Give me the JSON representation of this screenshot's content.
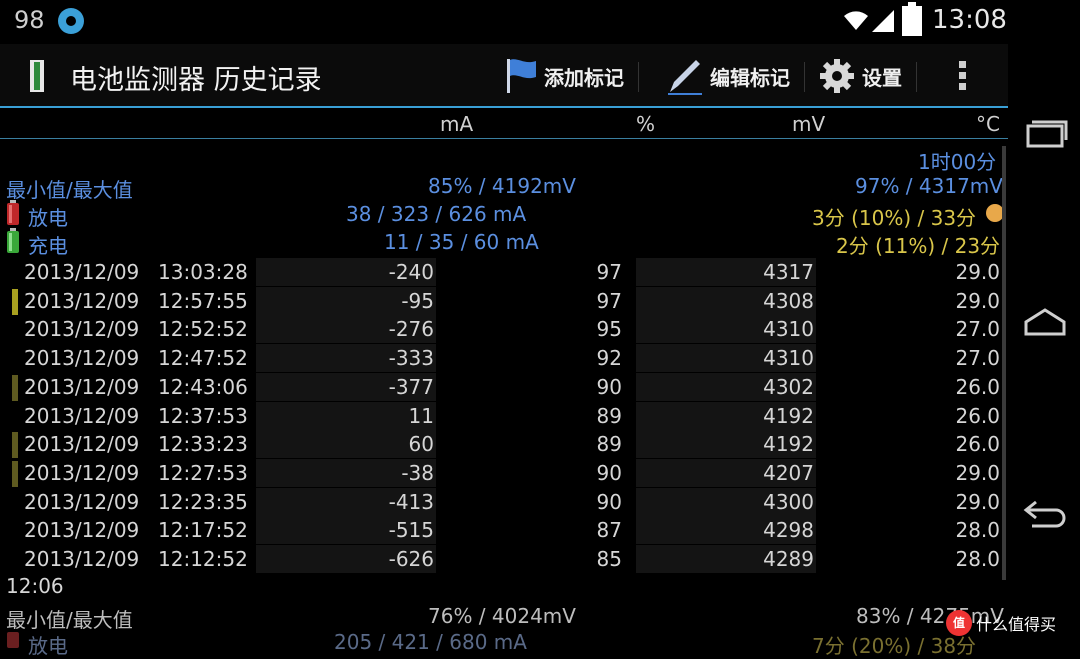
{
  "status_bar": {
    "battery_level": "98",
    "time": "13:08"
  },
  "action_bar": {
    "title": "电池监测器 历史记录",
    "add_mark": "添加标记",
    "edit_mark": "编辑标记",
    "settings": "设置"
  },
  "columns": {
    "ma": "mA",
    "pct": "%",
    "mv": "mV",
    "temp": "°C"
  },
  "summary1": {
    "duration": "1时00分",
    "minmax_label": "最小值/最大值",
    "min": "85% / 4192mV",
    "max": "97% / 4317mV",
    "discharge_label": "放电",
    "discharge_ma": "38 / 323 / 626 mA",
    "discharge_time": "3分 (10%) / 33分",
    "charge_label": "充电",
    "charge_ma": "11 / 35 / 60 mA",
    "charge_time": "2分 (11%) / 23分"
  },
  "records": [
    {
      "date": "2013/12/09",
      "time": "13:03:28",
      "ma": "-240",
      "pct": "97",
      "mv": "4317",
      "temp": "29.0",
      "marker": ""
    },
    {
      "date": "2013/12/09",
      "time": "12:57:55",
      "ma": "-95",
      "pct": "97",
      "mv": "4308",
      "temp": "29.0",
      "marker": "#a8a020"
    },
    {
      "date": "2013/12/09",
      "time": "12:52:52",
      "ma": "-276",
      "pct": "95",
      "mv": "4310",
      "temp": "27.0",
      "marker": ""
    },
    {
      "date": "2013/12/09",
      "time": "12:47:52",
      "ma": "-333",
      "pct": "92",
      "mv": "4310",
      "temp": "27.0",
      "marker": ""
    },
    {
      "date": "2013/12/09",
      "time": "12:43:06",
      "ma": "-377",
      "pct": "90",
      "mv": "4302",
      "temp": "26.0",
      "marker": "#5e5a20"
    },
    {
      "date": "2013/12/09",
      "time": "12:37:53",
      "ma": "11",
      "pct": "89",
      "mv": "4192",
      "temp": "26.0",
      "marker": ""
    },
    {
      "date": "2013/12/09",
      "time": "12:33:23",
      "ma": "60",
      "pct": "89",
      "mv": "4192",
      "temp": "26.0",
      "marker": "#5e5a20"
    },
    {
      "date": "2013/12/09",
      "time": "12:27:53",
      "ma": "-38",
      "pct": "90",
      "mv": "4207",
      "temp": "29.0",
      "marker": "#5e5a20"
    },
    {
      "date": "2013/12/09",
      "time": "12:23:35",
      "ma": "-413",
      "pct": "90",
      "mv": "4300",
      "temp": "29.0",
      "marker": ""
    },
    {
      "date": "2013/12/09",
      "time": "12:17:52",
      "ma": "-515",
      "pct": "87",
      "mv": "4298",
      "temp": "28.0",
      "marker": ""
    },
    {
      "date": "2013/12/09",
      "time": "12:12:52",
      "ma": "-626",
      "pct": "85",
      "mv": "4289",
      "temp": "28.0",
      "marker": ""
    }
  ],
  "summary2": {
    "time_label": "12:06",
    "minmax_label": "最小值/最大值",
    "min": "76% / 4024mV",
    "max": "83% / 4275mV",
    "discharge_label": "放电",
    "discharge_ma": "205 / 421 / 680 mA",
    "discharge_time": "7分 (20%) / 38分"
  },
  "watermark": {
    "text": "什么值得买",
    "badge": "值"
  }
}
